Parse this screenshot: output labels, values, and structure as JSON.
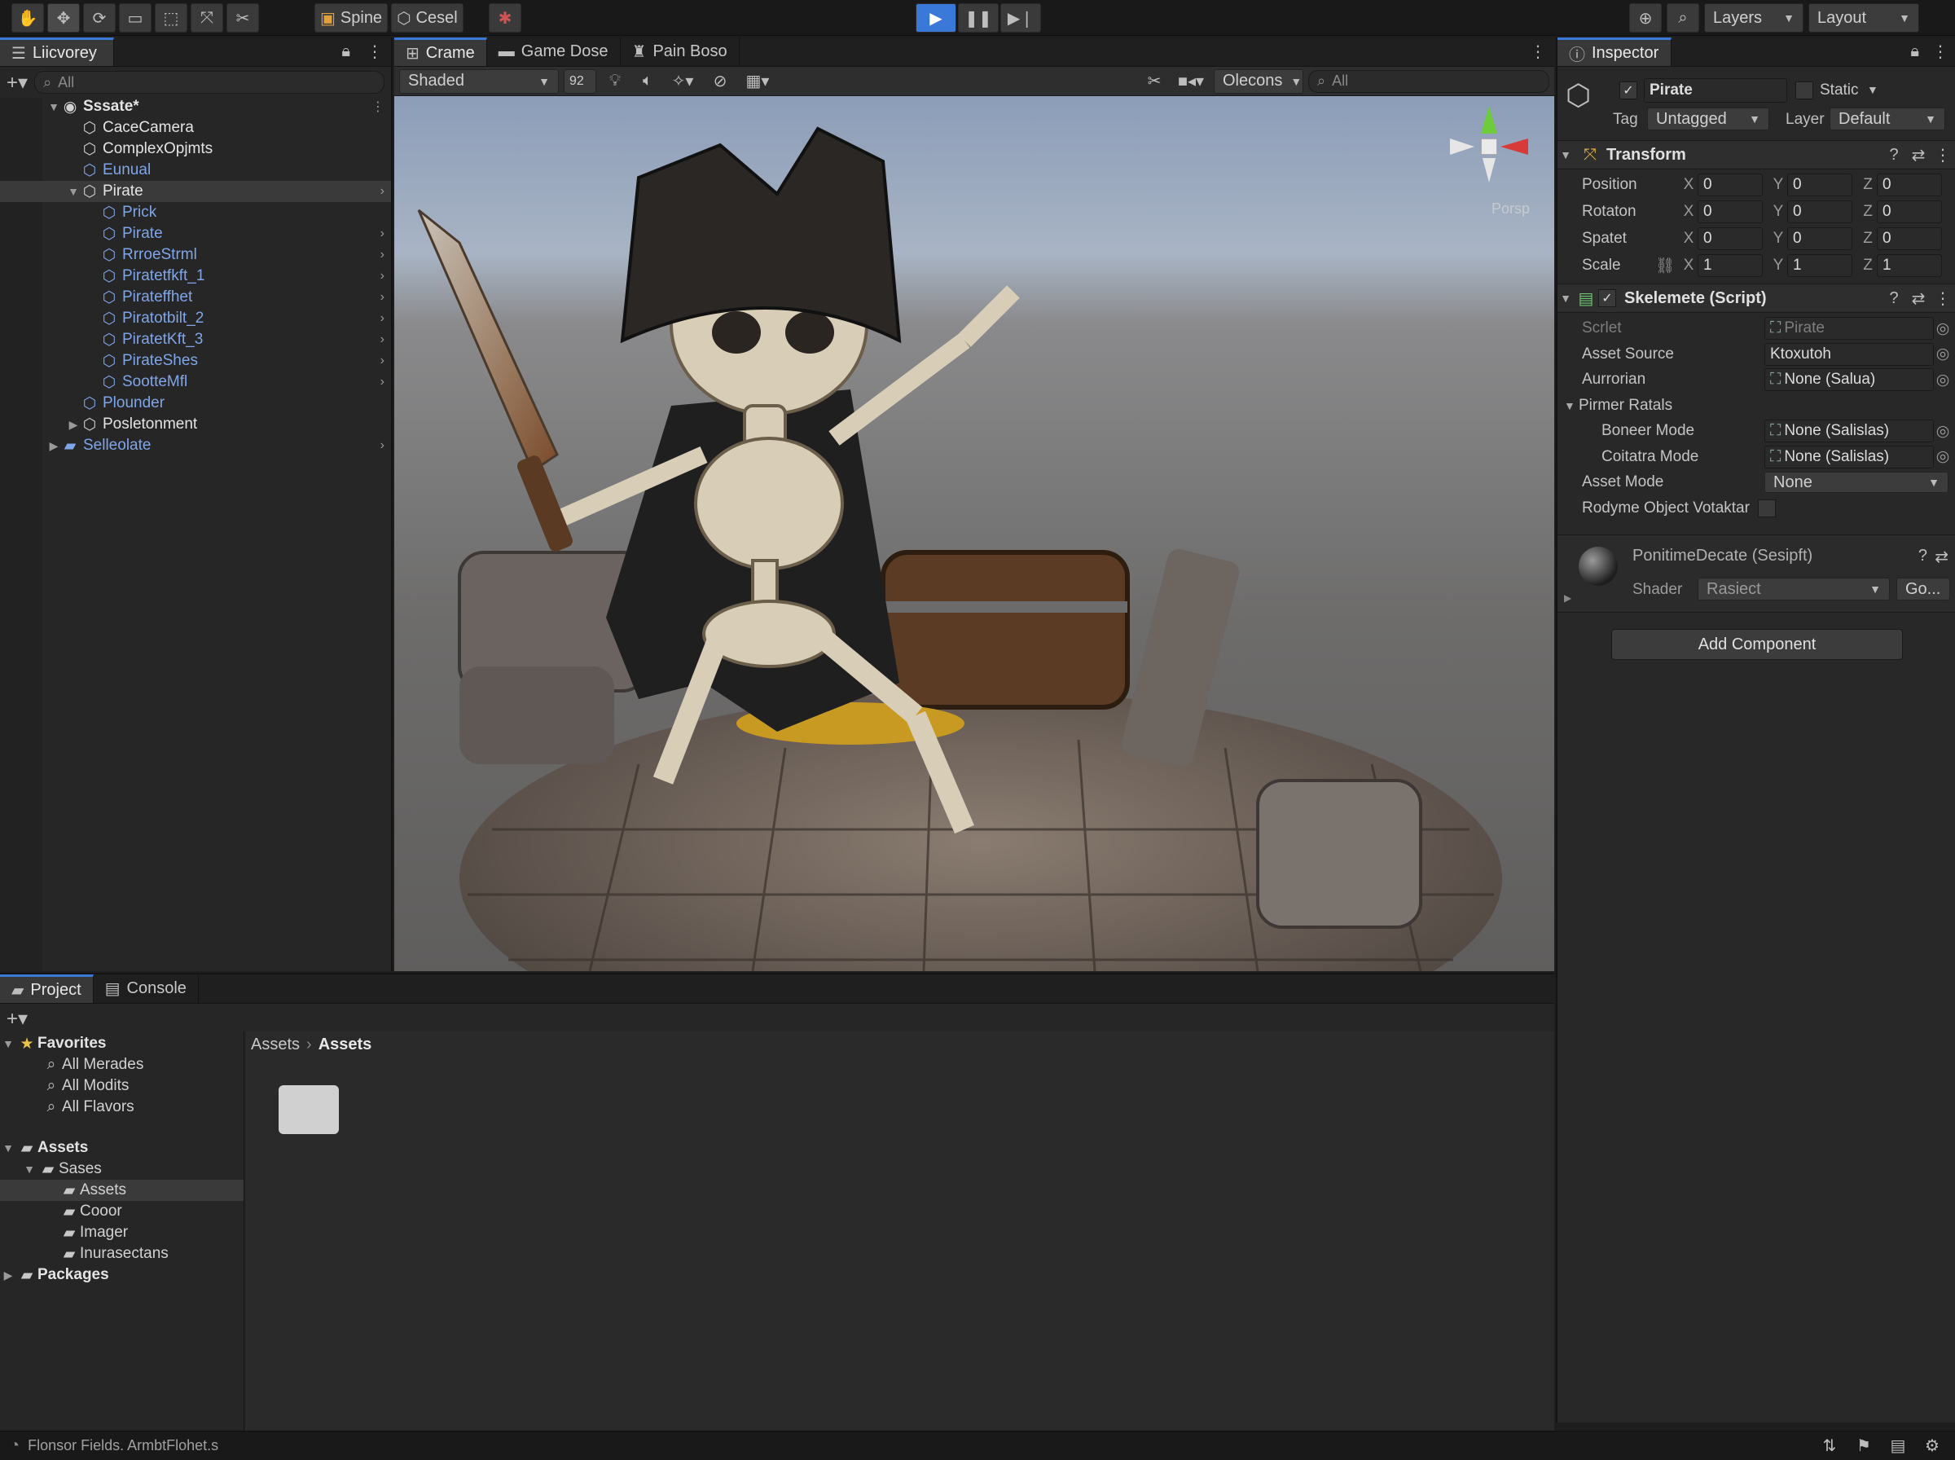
{
  "toolbar": {
    "tools": [
      "hand-icon",
      "move-icon",
      "rotate-icon",
      "rect-icon",
      "scale-icon",
      "transform-icon",
      "custom-tool-icon"
    ],
    "spine_label": "Spine",
    "cesel_label": "Cesel",
    "layers_label": "Layers",
    "layout_label": "Layout"
  },
  "hierarchy": {
    "tab": "Liicvorey",
    "search_placeholder": "All",
    "scene_name": "Sssate*",
    "items": [
      {
        "label": "CaceCamera",
        "depth": 1,
        "color": "white",
        "chev": false
      },
      {
        "label": "ComplexOpjmts",
        "depth": 1,
        "color": "white",
        "chev": false
      },
      {
        "label": "Eunual",
        "depth": 1,
        "color": "blue",
        "chev": false
      },
      {
        "label": "Pirate",
        "depth": 1,
        "color": "white",
        "chev": true,
        "selected": true,
        "expanded": true
      },
      {
        "label": "Prick",
        "depth": 2,
        "color": "blue",
        "chev": false
      },
      {
        "label": "Pirate",
        "depth": 2,
        "color": "blue",
        "chev": true
      },
      {
        "label": "RrroeStrml",
        "depth": 2,
        "color": "blue",
        "chev": true
      },
      {
        "label": "Piratetfkft_1",
        "depth": 2,
        "color": "blue",
        "chev": true
      },
      {
        "label": "Pirateffhet",
        "depth": 2,
        "color": "blue",
        "chev": true
      },
      {
        "label": "Piratotbilt_2",
        "depth": 2,
        "color": "blue",
        "chev": true
      },
      {
        "label": "PiratetKft_3",
        "depth": 2,
        "color": "blue",
        "chev": true
      },
      {
        "label": "PirateShes",
        "depth": 2,
        "color": "blue",
        "chev": true
      },
      {
        "label": "SootteMfl",
        "depth": 2,
        "color": "blue",
        "chev": true
      },
      {
        "label": "Plounder",
        "depth": 1,
        "color": "blue",
        "chev": false
      },
      {
        "label": "Posletonment",
        "depth": 1,
        "color": "white",
        "chev": false,
        "collapsed": true
      },
      {
        "label": "Selleolate",
        "depth": 0,
        "color": "blue",
        "chev": true,
        "folder": true,
        "collapsed": true
      }
    ]
  },
  "scene": {
    "tabs": [
      "Crame",
      "Game Dose",
      "Pain Boso"
    ],
    "shading": "Shaded",
    "zoom": "92",
    "gizmos": "Olecons",
    "search_placeholder": "All",
    "persp_label": "Porsp"
  },
  "inspector": {
    "tab": "Inspector",
    "object_name": "Pirate",
    "static_label": "Static",
    "tag_label": "Tag",
    "tag_value": "Untagged",
    "layer_label": "Layer",
    "layer_value": "Default",
    "transform": {
      "title": "Transform",
      "rows": [
        {
          "label": "Position",
          "x": "0",
          "y": "0",
          "z": "0"
        },
        {
          "label": "Rotaton",
          "x": "0",
          "y": "0",
          "z": "0"
        },
        {
          "label": "Spatet",
          "x": "0",
          "y": "0",
          "z": "0"
        },
        {
          "label": "Scale",
          "x": "1",
          "y": "1",
          "z": "1"
        }
      ]
    },
    "script": {
      "title": "Skelemete (Script)",
      "rows": [
        {
          "label": "Scrlet",
          "value": "Pirate",
          "dim": true
        },
        {
          "label": "Asset Source",
          "value": "Ktoxutoh"
        },
        {
          "label": "Aurrorian",
          "value": "None (Salua)"
        },
        {
          "label": "Pirmer Ratals",
          "value": ""
        },
        {
          "label": "Boneer Mode",
          "value": "None (Salislas)",
          "indent": true
        },
        {
          "label": "Coitatra Mode",
          "value": "None (Salislas)",
          "indent": true
        },
        {
          "label": "Asset Mode",
          "value": "None",
          "dropdown": true
        },
        {
          "label": "Rodyme Object Votaktar",
          "value": "",
          "checkbox": true
        }
      ]
    },
    "material": {
      "title": "PonitimeDecate (Sesipft)",
      "shader_label": "Shader",
      "shader_value": "Rasiect",
      "go_label": "Go..."
    },
    "add_component": "Add Component"
  },
  "project": {
    "tabs": [
      "Project",
      "Console"
    ],
    "favorites_label": "Favorites",
    "favorites": [
      "All Merades",
      "All Modits",
      "All Flavors"
    ],
    "assets_label": "Assets",
    "sases_label": "Sases",
    "subfolders": [
      "Assets",
      "Cooor",
      "Imager",
      "Inurasectans"
    ],
    "packages_label": "Packages",
    "breadcrumb": [
      "Assets",
      "Assets"
    ]
  },
  "status_bar": {
    "text": "Flonsor Fields. ArmbtFlohet.s"
  },
  "colors": {
    "accent": "#3a79d8",
    "panel": "#282828",
    "header": "#1f1f1f"
  }
}
